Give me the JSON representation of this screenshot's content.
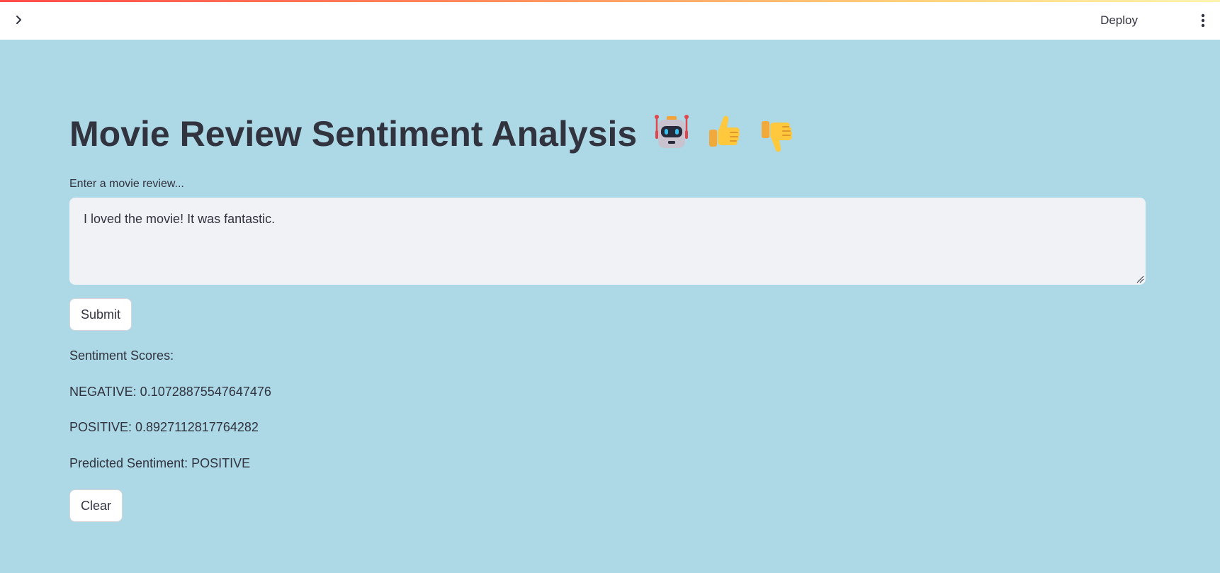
{
  "header": {
    "deploy_label": "Deploy",
    "sidebar_toggle_icon": "chevron-right-icon",
    "menu_icon": "kebab-menu-icon"
  },
  "main": {
    "title": "Movie Review Sentiment Analysis",
    "title_emojis": [
      "robot-icon",
      "thumbs-up-icon",
      "thumbs-down-icon"
    ],
    "input": {
      "label": "Enter a movie review...",
      "value": "I loved the movie! It was fantastic."
    },
    "submit_label": "Submit",
    "results": {
      "heading": "Sentiment Scores:",
      "negative": "NEGATIVE: 0.10728875547647476",
      "positive": "POSITIVE: 0.8927112817764282",
      "prediction": "Predicted Sentiment: POSITIVE"
    },
    "clear_label": "Clear"
  },
  "colors": {
    "background": "#add8e6",
    "header_bg": "#ffffff",
    "text": "#31333f",
    "input_bg": "#f0f2f6"
  }
}
